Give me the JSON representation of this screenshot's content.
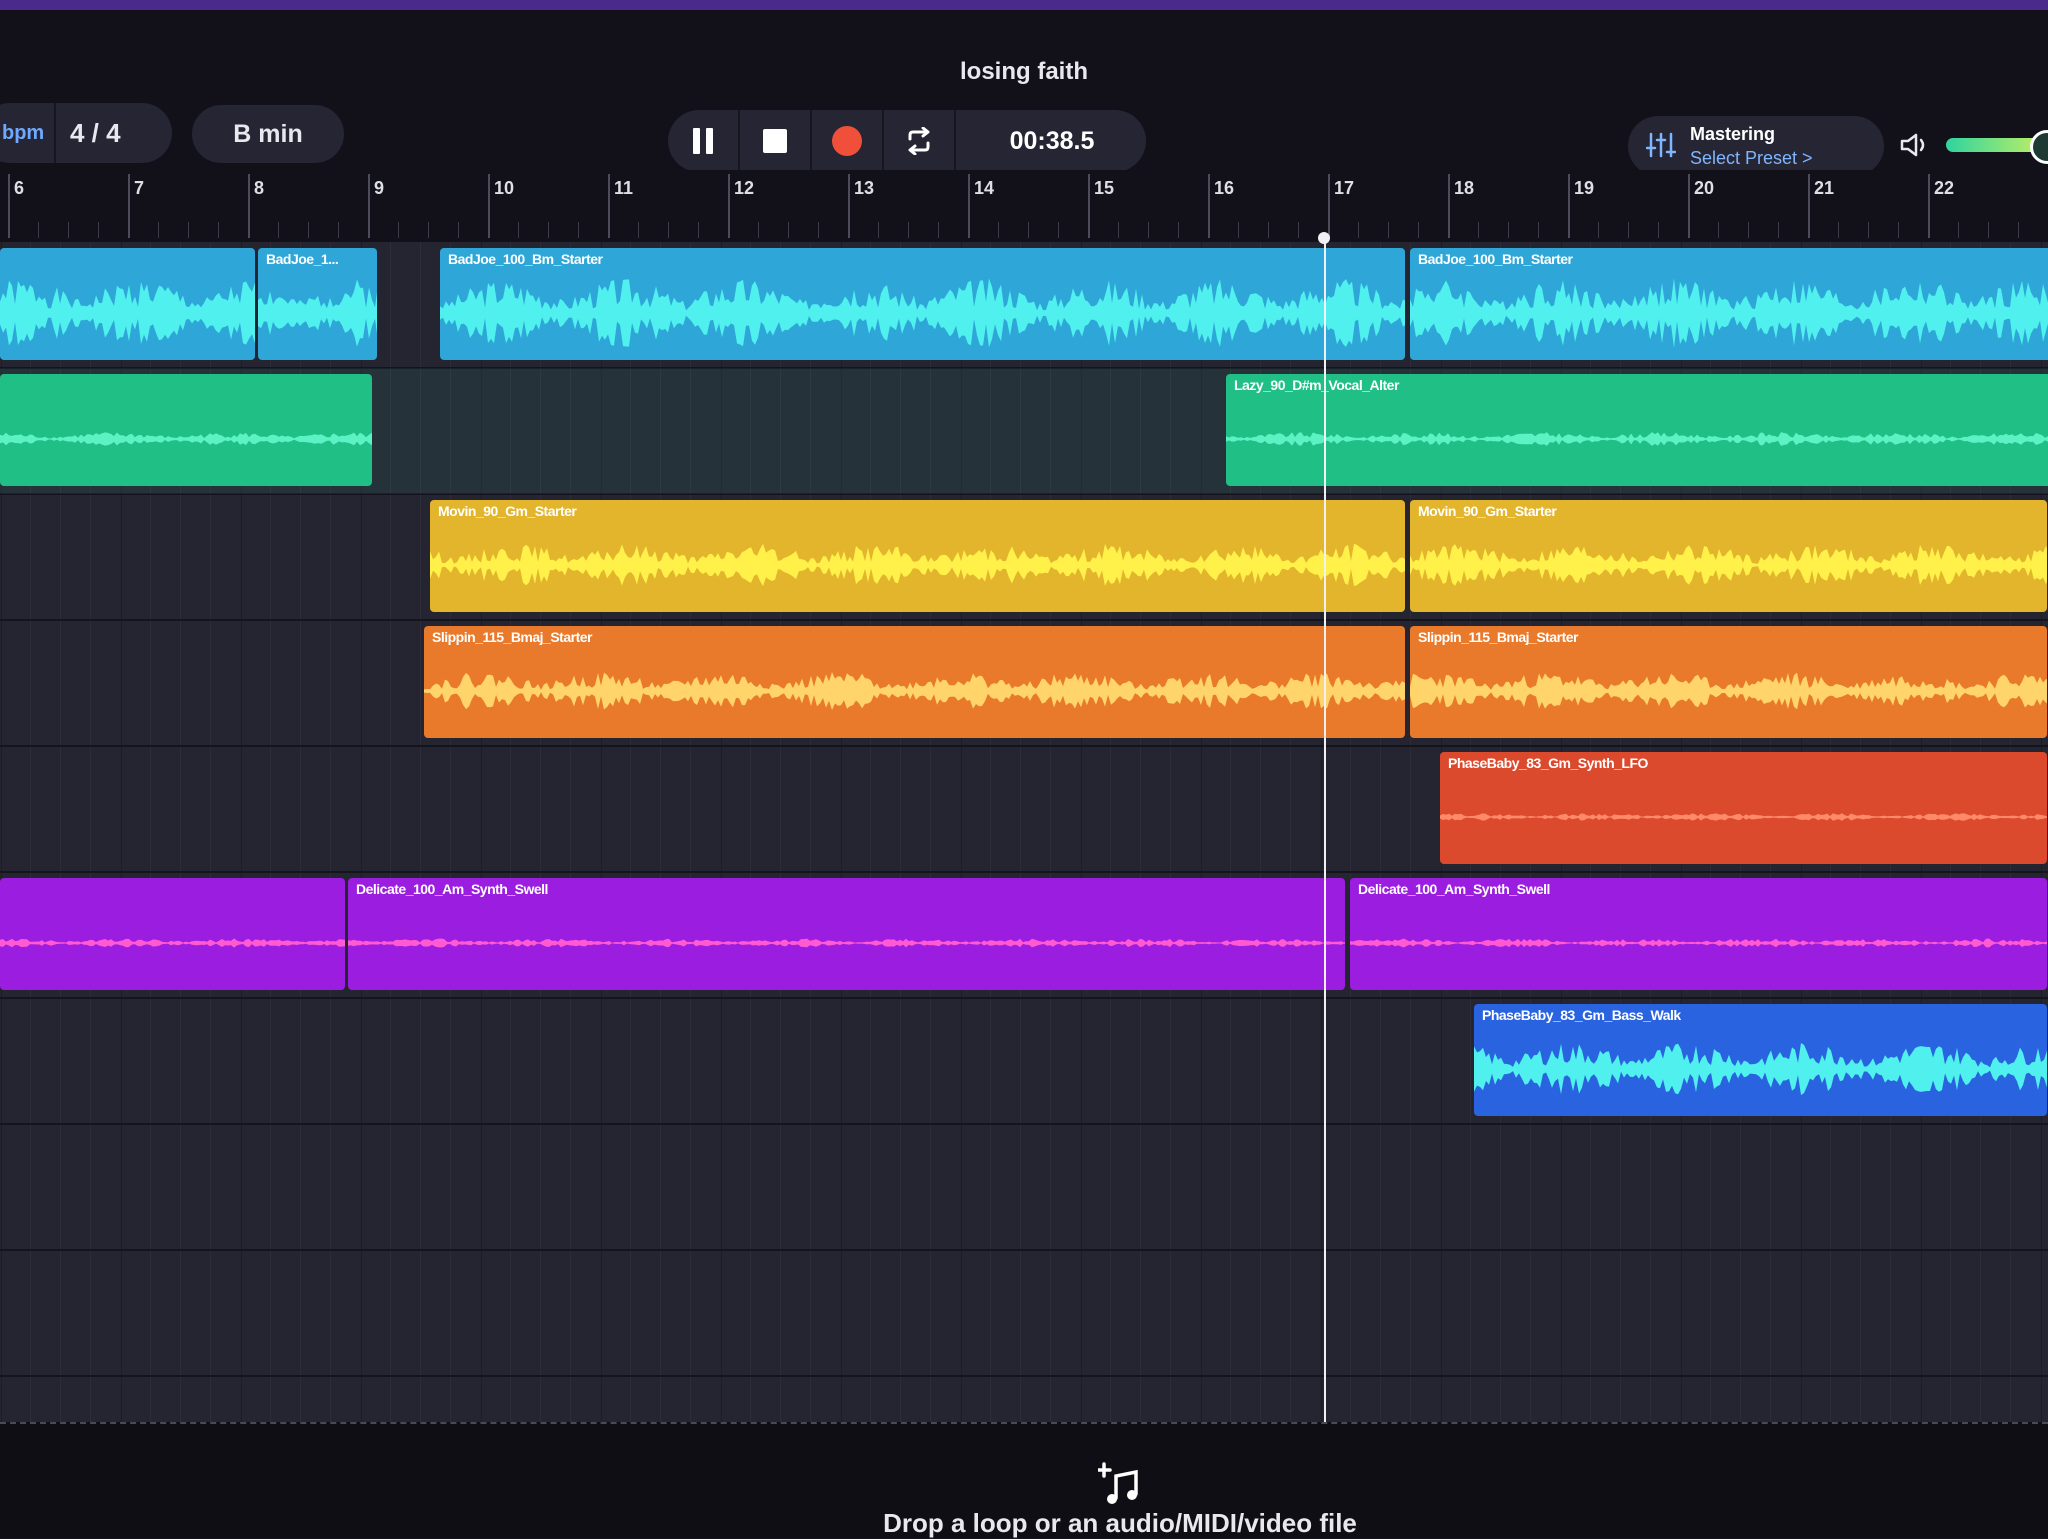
{
  "project": {
    "title": "losing faith"
  },
  "toolbar": {
    "bpm_label": "bpm",
    "time_signature": "4 / 4",
    "key": "B min",
    "time_display": "00:38.5",
    "mastering_title": "Mastering",
    "mastering_preset": "Select Preset >",
    "volume_level": 0.85
  },
  "ruler": {
    "bars": [
      "6",
      "7",
      "8",
      "9",
      "10",
      "11",
      "12",
      "13",
      "14",
      "15",
      "16",
      "17",
      "18",
      "19",
      "20",
      "21",
      "22"
    ]
  },
  "tracks": [
    {
      "color": "#2ea6d8",
      "wave_color": "#4ff0ee",
      "clips": [
        {
          "label": "BadJoe_1..."
        },
        {
          "label": "BadJoe_100_Bm_Starter"
        },
        {
          "label": "BadJoe_100_Bm_Starter"
        }
      ]
    },
    {
      "color": "#1fbf86",
      "wave_color": "#5df2c4",
      "clips": [
        {
          "label": ""
        },
        {
          "label": "Lazy_90_D#m_Vocal_Alter"
        }
      ]
    },
    {
      "color": "#e3b52c",
      "wave_color": "#fff04a",
      "clips": [
        {
          "label": "Movin_90_Gm_Starter"
        },
        {
          "label": "Movin_90_Gm_Starter"
        }
      ]
    },
    {
      "color": "#e97a2c",
      "wave_color": "#ffd46a",
      "clips": [
        {
          "label": "Slippin_115_Bmaj_Starter"
        },
        {
          "label": "Slippin_115_Bmaj_Starter"
        }
      ]
    },
    {
      "color": "#dc4a2e",
      "wave_color": "#ff8a6a",
      "clips": [
        {
          "label": "PhaseBaby_83_Gm_Synth_LFO"
        }
      ]
    },
    {
      "color": "#9b1de0",
      "wave_color": "#ff5ad2",
      "clips": [
        {
          "label": ""
        },
        {
          "label": "Delicate_100_Am_Synth_Swell"
        },
        {
          "label": "Delicate_100_Am_Synth_Swell"
        }
      ]
    },
    {
      "color": "#2a63e0",
      "wave_color": "#4ff0ee",
      "clips": [
        {
          "label": "PhaseBaby_83_Gm_Bass_Walk"
        }
      ]
    }
  ],
  "drop_zone": {
    "text": "Drop a loop or an audio/MIDI/video file"
  },
  "icons": [
    "pause-icon",
    "stop-icon",
    "record-icon",
    "loop-icon",
    "mixer-icon",
    "speaker-icon",
    "add-music-icon"
  ]
}
